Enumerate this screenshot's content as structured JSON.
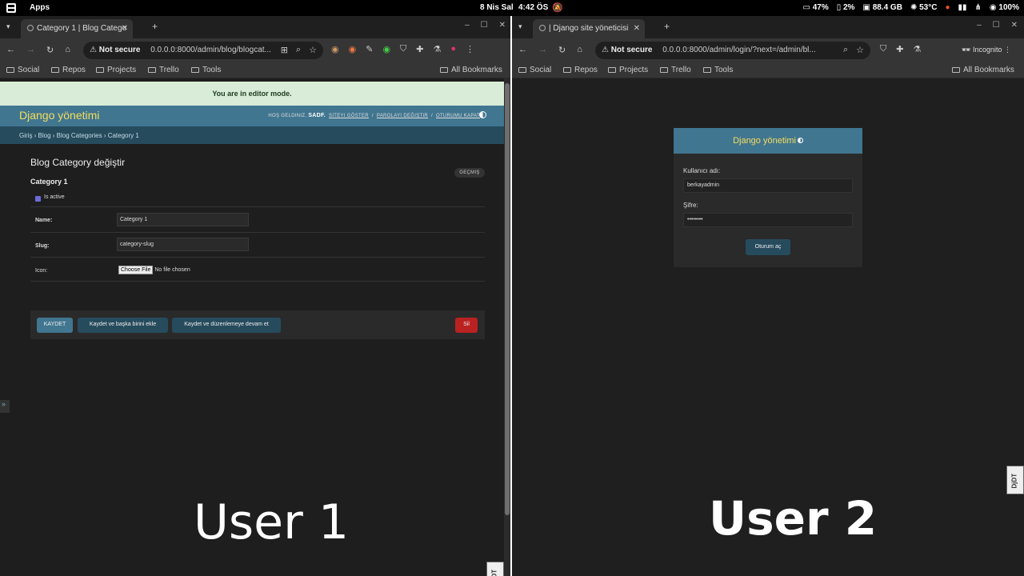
{
  "sysbar": {
    "apps": "Apps",
    "date": "8 Nis Sal",
    "time": "4:42 ÖS",
    "battery_main": "47%",
    "battery_2": "2%",
    "memory": "88.4 GB",
    "temp": "53°C",
    "volume": "100%"
  },
  "win1": {
    "tab_title": "Category 1 | Blog Catego",
    "not_secure": "Not secure",
    "url": "0.0.0.0:8000/admin/blog/blogcat...",
    "bookmarks": [
      "Social",
      "Repos",
      "Projects",
      "Trello",
      "Tools"
    ],
    "all_bookmarks": "All Bookmarks",
    "editor_banner": "You are in editor mode.",
    "brand": "Django yönetimi",
    "welcome": "HOŞ GELDINIZ,",
    "username": "SADF.",
    "view_site": "SITEYI GÖSTER",
    "change_password": "PAROLAYI DEĞIŞTIR",
    "logout": "OTURUMU KAPAT",
    "breadcrumbs": "Giriş › Blog › Blog Categories › Category 1",
    "content_title": "Blog Category değiştir",
    "history": "GEÇMIŞ",
    "object_title": "Category 1",
    "is_active_label": "Is active",
    "name_label": "Name:",
    "name_value": "Category 1",
    "slug_label": "Slug:",
    "slug_value": "category-slug",
    "icon_label": "Icon:",
    "choose_file": "Choose File",
    "no_file": "No file chosen",
    "save": "KAYDET",
    "save_add": "Kaydet ve başka birini ekle",
    "save_continue": "Kaydet ve düzenlemeye devam et",
    "delete": "Sil",
    "sidebar_toggle": "»",
    "overlay_label": "User 1",
    "djdt": "DjDT"
  },
  "win2": {
    "tab_title": "| Django site yöneticisi",
    "not_secure": "Not secure",
    "url": "0.0.0.0:8000/admin/login/?next=/admin/bl...",
    "incognito": "Incognito",
    "bookmarks": [
      "Social",
      "Repos",
      "Projects",
      "Trello",
      "Tools"
    ],
    "all_bookmarks": "All Bookmarks",
    "login_header": "Django yönetimi",
    "username_label": "Kullanıcı adı:",
    "username_value": "berkayadmin",
    "password_label": "Şifre:",
    "password_value": "••••••••",
    "login_button": "Oturum aç",
    "overlay_label": "User 2",
    "djdt": "DjDT"
  },
  "colors": {
    "django_primary": "#417690",
    "django_secondary": "#264b5d",
    "django_accent": "#f5dd5d",
    "delete_red": "#ba2121"
  }
}
